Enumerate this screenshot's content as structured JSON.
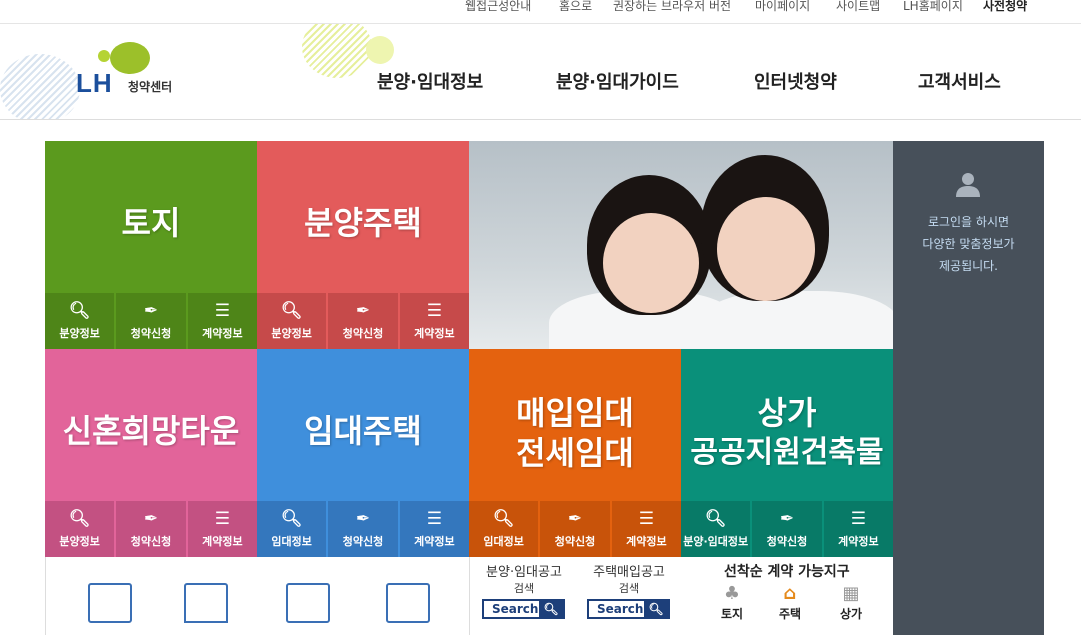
{
  "utility_nav": [
    "웹접근성안내",
    "홈으로",
    "권장하는 브라우저 버전",
    "마이페이지",
    "사이트맵",
    "LH홈페이지",
    "사전청약"
  ],
  "logo": {
    "mark": "LH",
    "subtitle": "청약센터"
  },
  "main_nav": [
    "분양·임대정보",
    "분양·임대가이드",
    "인터넷청약",
    "고객서비스"
  ],
  "tiles": {
    "land": {
      "title": "토지",
      "buttons": [
        "분양정보",
        "청약신청",
        "계약정보"
      ]
    },
    "sale_housing": {
      "title": "분양주택",
      "buttons": [
        "분양정보",
        "청약신청",
        "계약정보"
      ]
    },
    "newlywed": {
      "title": "신혼희망타운",
      "buttons": [
        "분양정보",
        "청약신청",
        "계약정보"
      ]
    },
    "rental": {
      "title": "임대주택",
      "buttons": [
        "임대정보",
        "청약신청",
        "계약정보"
      ]
    },
    "purchase_rental": {
      "title_line1": "매입임대",
      "title_line2": "전세임대",
      "buttons": [
        "임대정보",
        "청약신청",
        "계약정보"
      ]
    },
    "commercial": {
      "title_line1": "상가",
      "title_line2": "공공지원건축물",
      "buttons": [
        "분양·임대정보",
        "청약신청",
        "계약정보"
      ]
    }
  },
  "login_panel": {
    "line1": "로그인을 하시면",
    "line2": "다양한 맞춤정보가",
    "line3": "제공됩니다."
  },
  "search_blocks": [
    {
      "line1": "분양·임대공고",
      "line2": "검색",
      "button": "Search"
    },
    {
      "line1": "주택매입공고",
      "line2": "검색",
      "button": "Search"
    }
  ],
  "first_come": {
    "title": "선착순 계약 가능지구",
    "items": [
      "토지",
      "주택",
      "상가"
    ]
  },
  "colors": {
    "green": "#5b9a1e",
    "green_dark": "#4e8518",
    "red": "#e35b5b",
    "red_dark": "#c64a4a",
    "pink": "#e2649a",
    "pink_dark": "#c35182",
    "blue": "#3f8fdc",
    "blue_dark": "#3477bd",
    "orange": "#e4620f",
    "orange_dark": "#c8530a",
    "teal": "#0a907a",
    "teal_dark": "#087a67",
    "panel": "#47505a"
  }
}
